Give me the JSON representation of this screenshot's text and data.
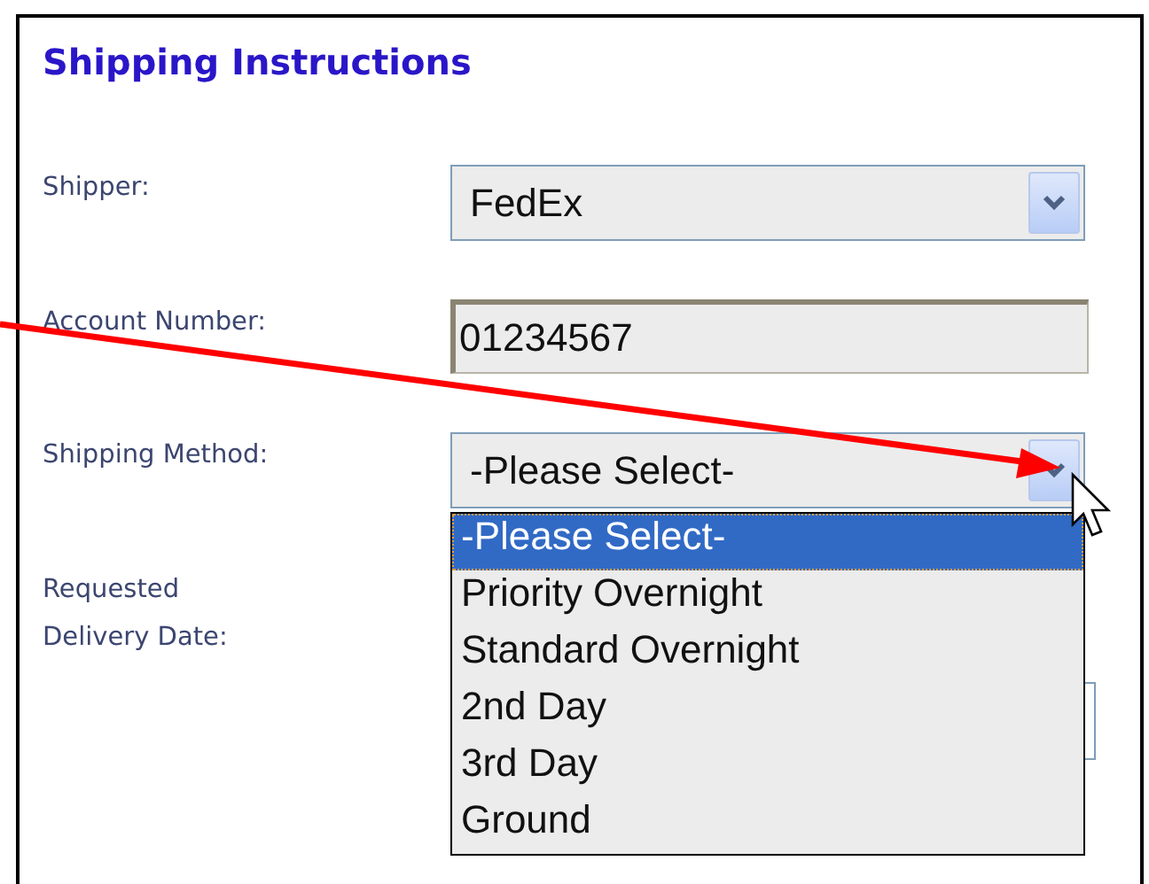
{
  "title": "Shipping Instructions",
  "fields": [
    {
      "kind": "select",
      "label": "Shipper:",
      "value": "FedEx"
    },
    {
      "kind": "text",
      "label": "Account Number:",
      "value": "01234567"
    },
    {
      "kind": "select",
      "label": "Shipping Method:",
      "value": "-Please Select-",
      "expanded": true,
      "options": [
        {
          "label": "-Please Select-",
          "selected": true
        },
        {
          "label": "Priority Overnight",
          "selected": false
        },
        {
          "label": "Standard Overnight",
          "selected": false
        },
        {
          "label": "2nd Day",
          "selected": false
        },
        {
          "label": "3rd Day",
          "selected": false
        },
        {
          "label": "Ground",
          "selected": false
        }
      ]
    },
    {
      "kind": "date",
      "label": "Requested\nDelivery Date:"
    }
  ]
}
